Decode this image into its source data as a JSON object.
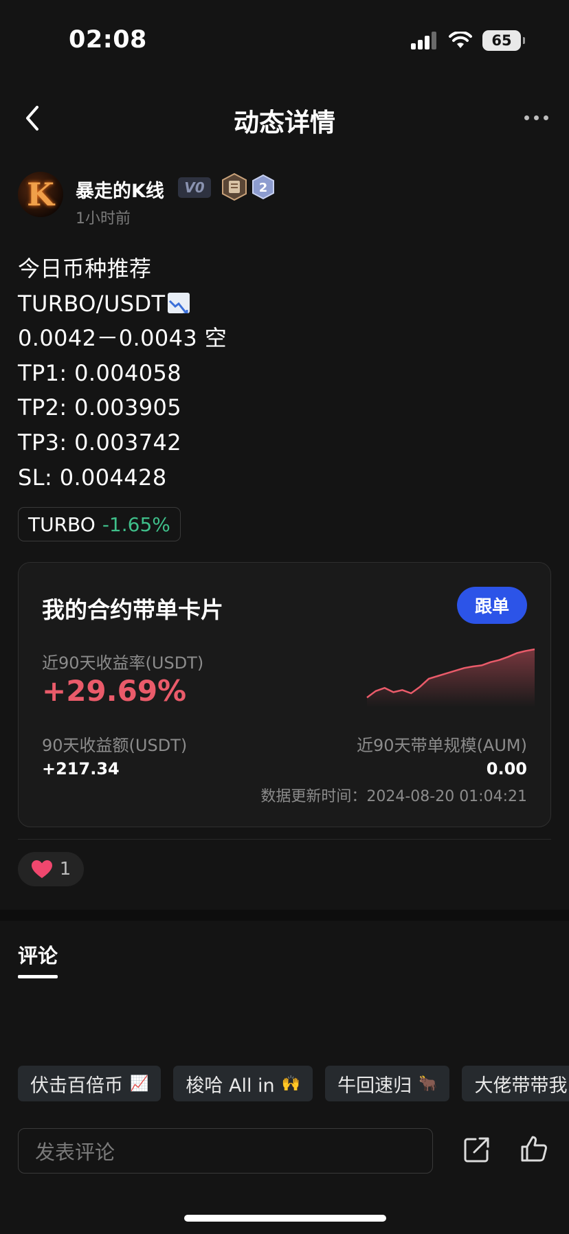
{
  "status_bar": {
    "time": "02:08",
    "battery": "65"
  },
  "nav": {
    "title": "动态详情"
  },
  "author": {
    "name": "暴走的K线",
    "level": "V0",
    "medal_level": "2",
    "avatar_letter": "K",
    "post_time": "1小时前"
  },
  "post": {
    "lines": [
      "今日币种推荐",
      "TURBO/USDT",
      "0.0042－0.0043 空",
      "TP1: 0.004058",
      "TP2: 0.003905",
      "TP3: 0.003742",
      "SL: 0.004428"
    ],
    "coin_tag": {
      "symbol": "TURBO",
      "change": "-1.65%"
    }
  },
  "card": {
    "title": "我的合约带单卡片",
    "follow_button": "跟单",
    "roi_label": "近90天收益率(USDT)",
    "roi_value": "+29.69%",
    "profit_label": "90天收益额(USDT)",
    "profit_value": "+217.34",
    "aum_label": "近90天带单规模(AUM)",
    "aum_value": "0.00",
    "update_time": "数据更新时间：2024-08-20 01:04:21",
    "sparkline": [
      0.1,
      0.22,
      0.28,
      0.2,
      0.24,
      0.18,
      0.3,
      0.45,
      0.5,
      0.55,
      0.6,
      0.65,
      0.68,
      0.7,
      0.76,
      0.8,
      0.86,
      0.93,
      0.97,
      1.0
    ]
  },
  "reactions": {
    "like_count": "1"
  },
  "comments": {
    "tab_label": "评论"
  },
  "quick_chips": [
    {
      "label": "伏击百倍币",
      "emoji": "📈"
    },
    {
      "label": "梭哈 All in",
      "emoji": "🙌"
    },
    {
      "label": "牛回速归",
      "emoji": "🐂"
    },
    {
      "label": "大佬带带我",
      "emoji": ""
    }
  ],
  "comment_input": {
    "placeholder": "发表评论"
  },
  "colors": {
    "accent_blue": "#2c54e8",
    "profit_red": "#ea5b6a",
    "change_green": "#3fbf8a"
  }
}
